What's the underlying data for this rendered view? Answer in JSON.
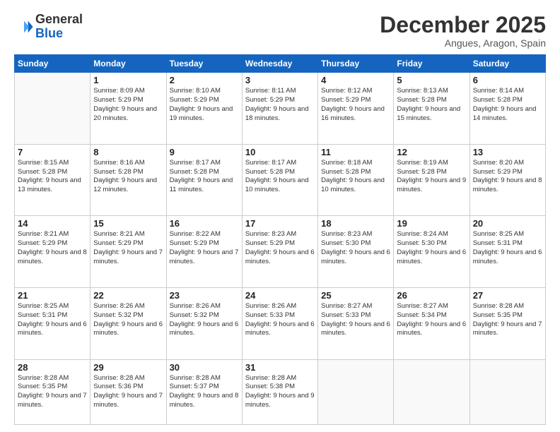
{
  "header": {
    "logo_text_general": "General",
    "logo_text_blue": "Blue",
    "month": "December 2025",
    "location": "Angues, Aragon, Spain"
  },
  "days_of_week": [
    "Sunday",
    "Monday",
    "Tuesday",
    "Wednesday",
    "Thursday",
    "Friday",
    "Saturday"
  ],
  "weeks": [
    [
      {
        "day": "",
        "sunrise": "",
        "sunset": "",
        "daylight": ""
      },
      {
        "day": "1",
        "sunrise": "Sunrise: 8:09 AM",
        "sunset": "Sunset: 5:29 PM",
        "daylight": "Daylight: 9 hours and 20 minutes."
      },
      {
        "day": "2",
        "sunrise": "Sunrise: 8:10 AM",
        "sunset": "Sunset: 5:29 PM",
        "daylight": "Daylight: 9 hours and 19 minutes."
      },
      {
        "day": "3",
        "sunrise": "Sunrise: 8:11 AM",
        "sunset": "Sunset: 5:29 PM",
        "daylight": "Daylight: 9 hours and 18 minutes."
      },
      {
        "day": "4",
        "sunrise": "Sunrise: 8:12 AM",
        "sunset": "Sunset: 5:29 PM",
        "daylight": "Daylight: 9 hours and 16 minutes."
      },
      {
        "day": "5",
        "sunrise": "Sunrise: 8:13 AM",
        "sunset": "Sunset: 5:28 PM",
        "daylight": "Daylight: 9 hours and 15 minutes."
      },
      {
        "day": "6",
        "sunrise": "Sunrise: 8:14 AM",
        "sunset": "Sunset: 5:28 PM",
        "daylight": "Daylight: 9 hours and 14 minutes."
      }
    ],
    [
      {
        "day": "7",
        "sunrise": "Sunrise: 8:15 AM",
        "sunset": "Sunset: 5:28 PM",
        "daylight": "Daylight: 9 hours and 13 minutes."
      },
      {
        "day": "8",
        "sunrise": "Sunrise: 8:16 AM",
        "sunset": "Sunset: 5:28 PM",
        "daylight": "Daylight: 9 hours and 12 minutes."
      },
      {
        "day": "9",
        "sunrise": "Sunrise: 8:17 AM",
        "sunset": "Sunset: 5:28 PM",
        "daylight": "Daylight: 9 hours and 11 minutes."
      },
      {
        "day": "10",
        "sunrise": "Sunrise: 8:17 AM",
        "sunset": "Sunset: 5:28 PM",
        "daylight": "Daylight: 9 hours and 10 minutes."
      },
      {
        "day": "11",
        "sunrise": "Sunrise: 8:18 AM",
        "sunset": "Sunset: 5:28 PM",
        "daylight": "Daylight: 9 hours and 10 minutes."
      },
      {
        "day": "12",
        "sunrise": "Sunrise: 8:19 AM",
        "sunset": "Sunset: 5:28 PM",
        "daylight": "Daylight: 9 hours and 9 minutes."
      },
      {
        "day": "13",
        "sunrise": "Sunrise: 8:20 AM",
        "sunset": "Sunset: 5:29 PM",
        "daylight": "Daylight: 9 hours and 8 minutes."
      }
    ],
    [
      {
        "day": "14",
        "sunrise": "Sunrise: 8:21 AM",
        "sunset": "Sunset: 5:29 PM",
        "daylight": "Daylight: 9 hours and 8 minutes."
      },
      {
        "day": "15",
        "sunrise": "Sunrise: 8:21 AM",
        "sunset": "Sunset: 5:29 PM",
        "daylight": "Daylight: 9 hours and 7 minutes."
      },
      {
        "day": "16",
        "sunrise": "Sunrise: 8:22 AM",
        "sunset": "Sunset: 5:29 PM",
        "daylight": "Daylight: 9 hours and 7 minutes."
      },
      {
        "day": "17",
        "sunrise": "Sunrise: 8:23 AM",
        "sunset": "Sunset: 5:29 PM",
        "daylight": "Daylight: 9 hours and 6 minutes."
      },
      {
        "day": "18",
        "sunrise": "Sunrise: 8:23 AM",
        "sunset": "Sunset: 5:30 PM",
        "daylight": "Daylight: 9 hours and 6 minutes."
      },
      {
        "day": "19",
        "sunrise": "Sunrise: 8:24 AM",
        "sunset": "Sunset: 5:30 PM",
        "daylight": "Daylight: 9 hours and 6 minutes."
      },
      {
        "day": "20",
        "sunrise": "Sunrise: 8:25 AM",
        "sunset": "Sunset: 5:31 PM",
        "daylight": "Daylight: 9 hours and 6 minutes."
      }
    ],
    [
      {
        "day": "21",
        "sunrise": "Sunrise: 8:25 AM",
        "sunset": "Sunset: 5:31 PM",
        "daylight": "Daylight: 9 hours and 6 minutes."
      },
      {
        "day": "22",
        "sunrise": "Sunrise: 8:26 AM",
        "sunset": "Sunset: 5:32 PM",
        "daylight": "Daylight: 9 hours and 6 minutes."
      },
      {
        "day": "23",
        "sunrise": "Sunrise: 8:26 AM",
        "sunset": "Sunset: 5:32 PM",
        "daylight": "Daylight: 9 hours and 6 minutes."
      },
      {
        "day": "24",
        "sunrise": "Sunrise: 8:26 AM",
        "sunset": "Sunset: 5:33 PM",
        "daylight": "Daylight: 9 hours and 6 minutes."
      },
      {
        "day": "25",
        "sunrise": "Sunrise: 8:27 AM",
        "sunset": "Sunset: 5:33 PM",
        "daylight": "Daylight: 9 hours and 6 minutes."
      },
      {
        "day": "26",
        "sunrise": "Sunrise: 8:27 AM",
        "sunset": "Sunset: 5:34 PM",
        "daylight": "Daylight: 9 hours and 6 minutes."
      },
      {
        "day": "27",
        "sunrise": "Sunrise: 8:28 AM",
        "sunset": "Sunset: 5:35 PM",
        "daylight": "Daylight: 9 hours and 7 minutes."
      }
    ],
    [
      {
        "day": "28",
        "sunrise": "Sunrise: 8:28 AM",
        "sunset": "Sunset: 5:35 PM",
        "daylight": "Daylight: 9 hours and 7 minutes."
      },
      {
        "day": "29",
        "sunrise": "Sunrise: 8:28 AM",
        "sunset": "Sunset: 5:36 PM",
        "daylight": "Daylight: 9 hours and 7 minutes."
      },
      {
        "day": "30",
        "sunrise": "Sunrise: 8:28 AM",
        "sunset": "Sunset: 5:37 PM",
        "daylight": "Daylight: 9 hours and 8 minutes."
      },
      {
        "day": "31",
        "sunrise": "Sunrise: 8:28 AM",
        "sunset": "Sunset: 5:38 PM",
        "daylight": "Daylight: 9 hours and 9 minutes."
      },
      {
        "day": "",
        "sunrise": "",
        "sunset": "",
        "daylight": ""
      },
      {
        "day": "",
        "sunrise": "",
        "sunset": "",
        "daylight": ""
      },
      {
        "day": "",
        "sunrise": "",
        "sunset": "",
        "daylight": ""
      }
    ]
  ]
}
